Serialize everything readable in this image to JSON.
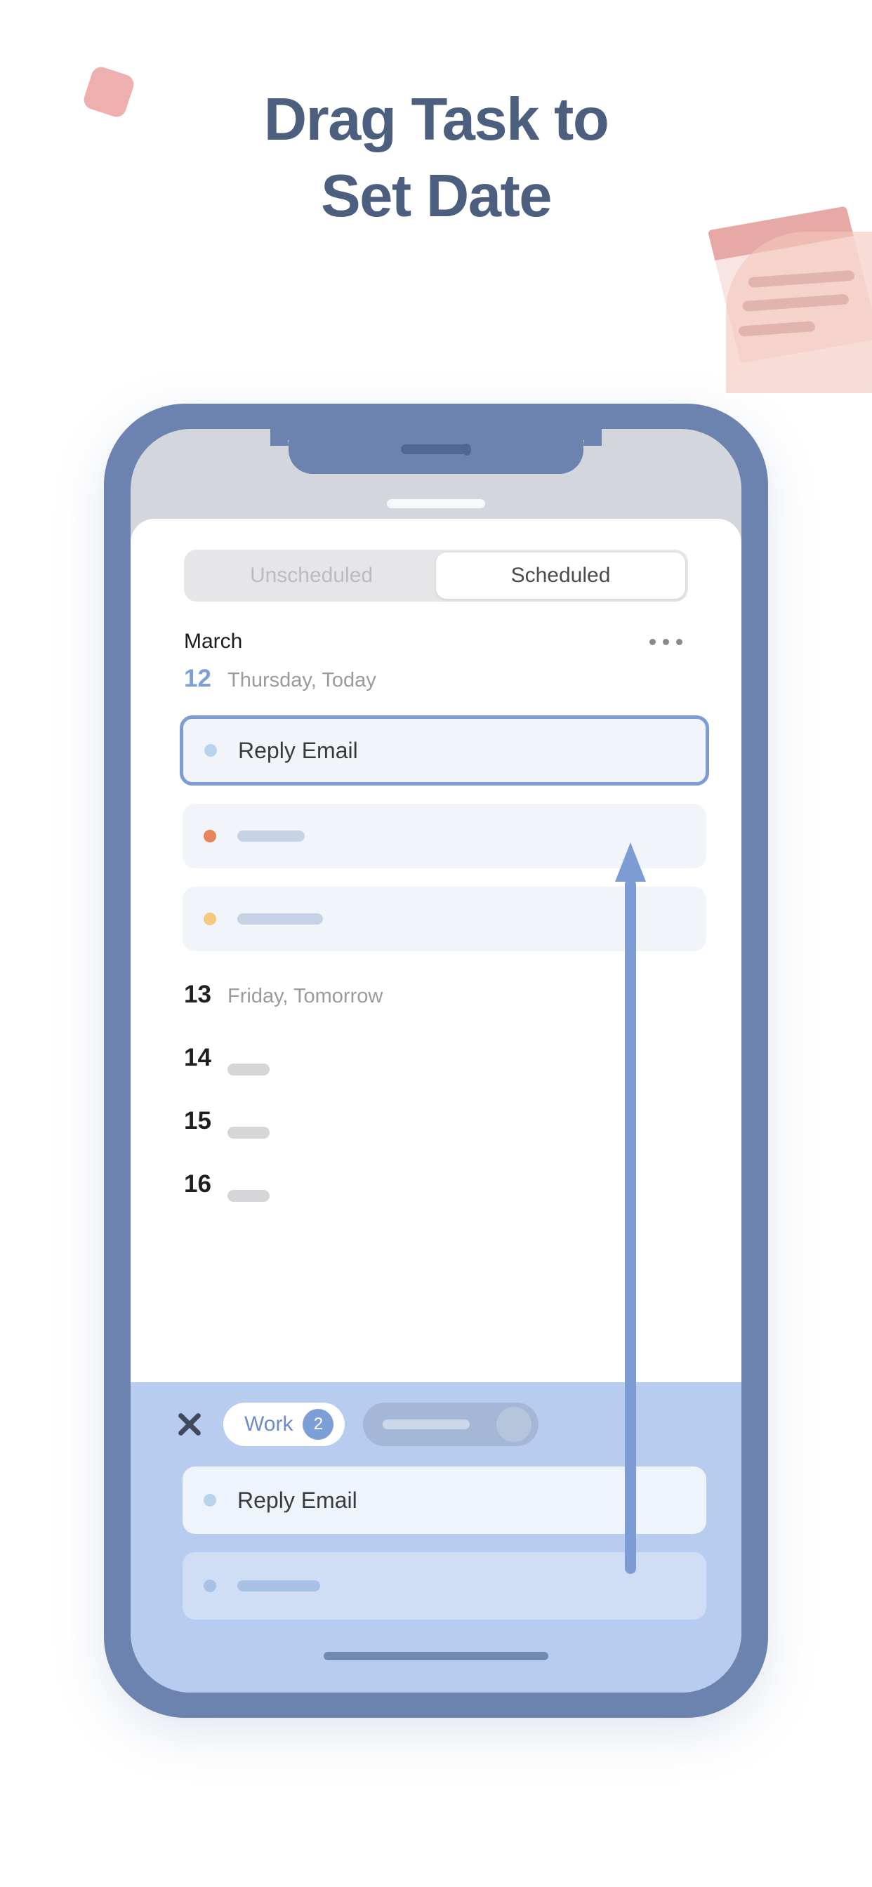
{
  "headline": {
    "line1": "Drag Task to",
    "line2": "Set Date",
    "color": "#4c5f7e"
  },
  "decor": {
    "pink_square": "pink-square-decoration",
    "note": "sticky-note-illustration"
  },
  "phone": {
    "frame_color": "#6b83ae",
    "status_pill": "status-bar-pill"
  },
  "app": {
    "tabs": [
      {
        "label": "Unscheduled",
        "active": false
      },
      {
        "label": "Scheduled",
        "active": true
      }
    ],
    "month": "March",
    "more_icon": "more-options-icon",
    "days": [
      {
        "num": "12",
        "name": "Thursday, Today",
        "today": true,
        "tasks": [
          {
            "title": "Reply Email",
            "dot": "blue",
            "selected": true
          },
          {
            "title": "",
            "dot": "orange",
            "selected": false,
            "skeleton_width": 96
          },
          {
            "title": "",
            "dot": "yellow",
            "selected": false,
            "skeleton_width": 122
          }
        ]
      },
      {
        "num": "13",
        "name": "Friday, Tomorrow",
        "today": false,
        "tasks": []
      },
      {
        "num": "14",
        "name": "",
        "today": false,
        "skeleton": true,
        "tasks": []
      },
      {
        "num": "15",
        "name": "",
        "today": false,
        "skeleton": true,
        "tasks": []
      },
      {
        "num": "16",
        "name": "",
        "today": false,
        "skeleton": true,
        "tasks": []
      }
    ]
  },
  "drawer": {
    "background": "#b7ccee",
    "close_icon": "close-icon",
    "chip": {
      "label": "Work",
      "badge": "2"
    },
    "chip_ghost": "filter-chip-placeholder",
    "tasks": [
      {
        "title": "Reply Email",
        "dot": "blue",
        "ghost": false
      },
      {
        "title": "",
        "dot": "ghost-dot",
        "ghost": true,
        "skeleton_width": 118
      }
    ],
    "home_indicator": "home-indicator"
  },
  "arrow": {
    "name": "drag-direction-arrow",
    "color": "#7d9cd4"
  }
}
